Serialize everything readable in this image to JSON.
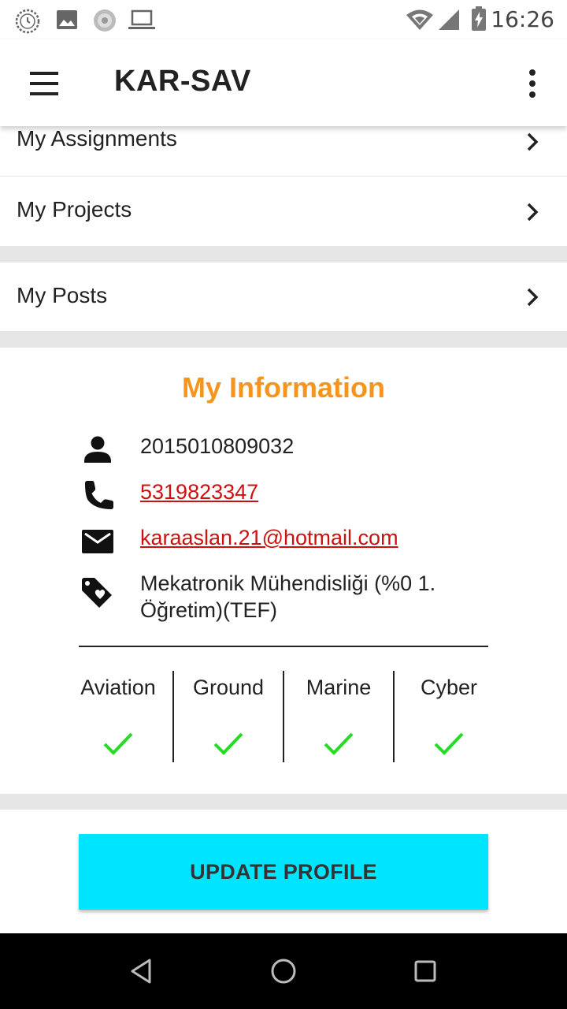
{
  "status_bar": {
    "time": "16:26",
    "icons": [
      "clock-notification-icon",
      "image-notification-icon",
      "sync-notification-icon",
      "laptop-notification-icon",
      "wifi-icon",
      "signal-icon",
      "battery-charging-icon"
    ]
  },
  "app_bar": {
    "title": "KAR-SAV",
    "menu_icon": "hamburger-menu-icon",
    "overflow_icon": "more-vert-icon"
  },
  "menu": {
    "assignments": "My Assignments",
    "projects": "My Projects",
    "posts": "My Posts"
  },
  "info": {
    "title": "My Information",
    "student_id": "2015010809032",
    "phone": "5319823347",
    "email": "karaaslan.21@hotmail.com",
    "department": "Mekatronik Mühendisliği (%0 1. Öğretim)(TEF)"
  },
  "categories": [
    {
      "label": "Aviation",
      "checked": true
    },
    {
      "label": "Ground",
      "checked": true
    },
    {
      "label": "Marine",
      "checked": true
    },
    {
      "label": "Cyber",
      "checked": true
    }
  ],
  "update_button": "UPDATE PROFILE",
  "colors": {
    "accent_title": "#f5951e",
    "link": "#cc1111",
    "check": "#22dd22",
    "button": "#00e5ff"
  },
  "nav": {
    "back_icon": "back-triangle-icon",
    "home_icon": "home-circle-icon",
    "recents_icon": "recents-square-icon"
  }
}
